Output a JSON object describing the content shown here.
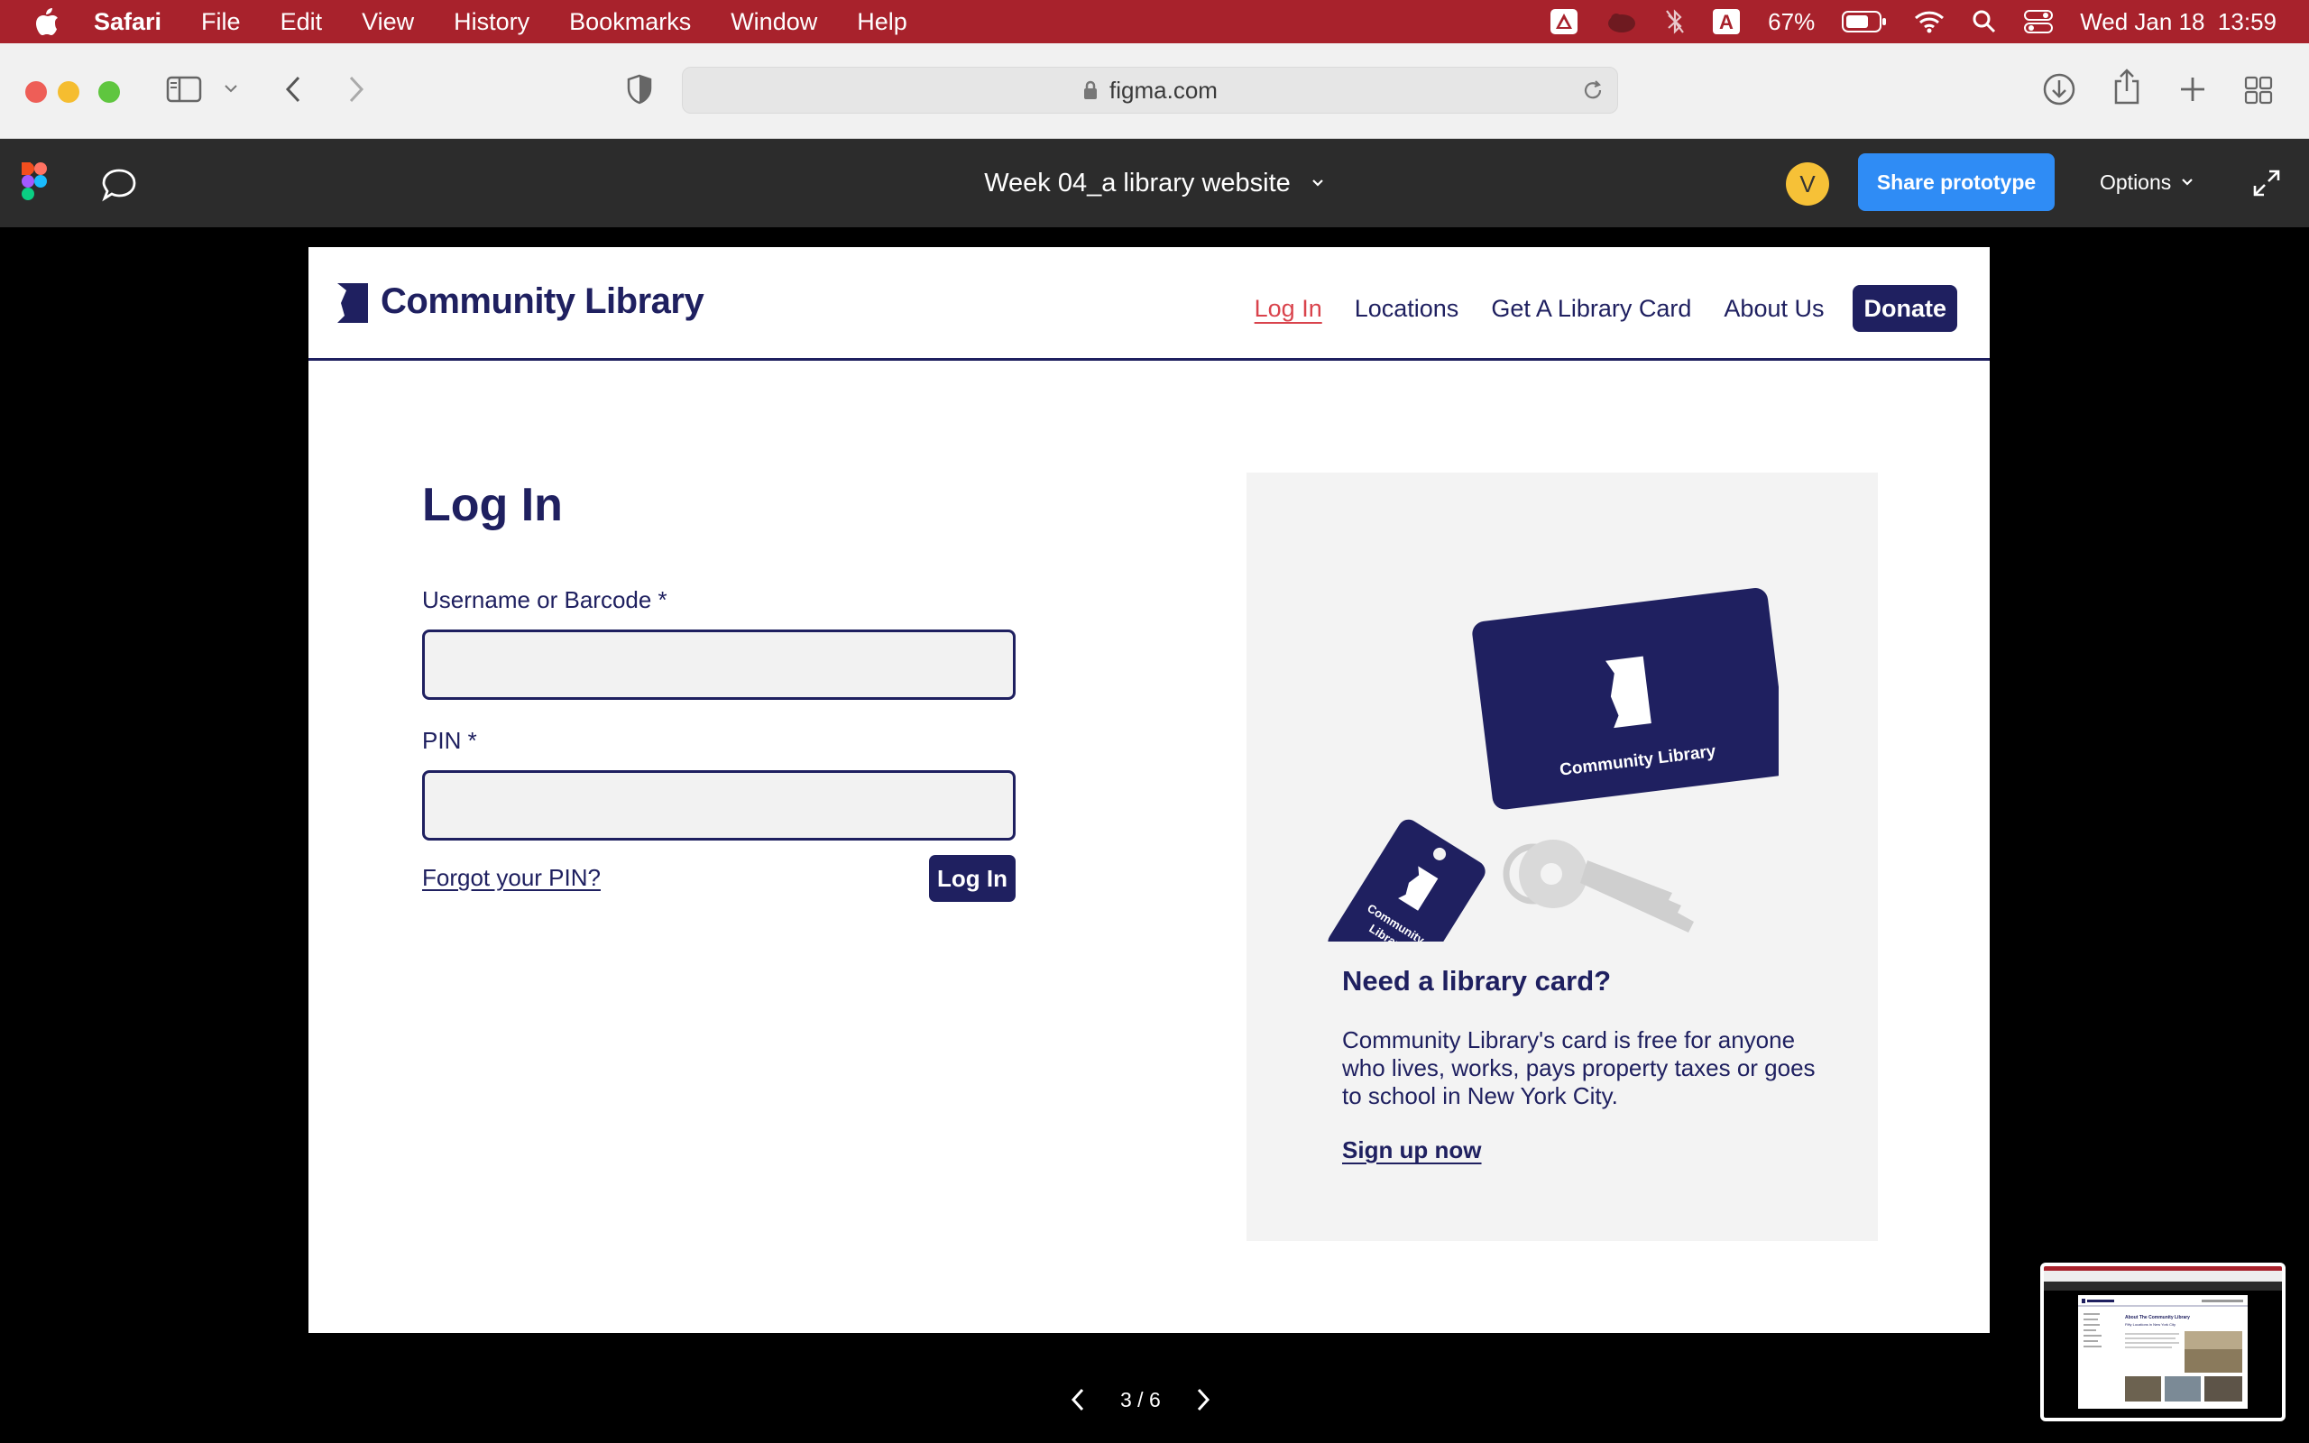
{
  "menubar": {
    "app": "Safari",
    "items": [
      "File",
      "Edit",
      "View",
      "History",
      "Bookmarks",
      "Window",
      "Help"
    ],
    "battery": "67%",
    "datetime": "Wed Jan 18  13:59",
    "font_icon_letter": "A"
  },
  "safari": {
    "url": "figma.com"
  },
  "figma": {
    "file_title": "Week 04_a library website",
    "avatar_initial": "V",
    "share_label": "Share prototype",
    "options_label": "Options"
  },
  "site": {
    "logo_text": "Community Library",
    "nav": [
      "Log In",
      "Locations",
      "Get A Library Card",
      "About Us"
    ],
    "donate": "Donate",
    "login": {
      "title": "Log In",
      "username_label": "Username or Barcode *",
      "username_value": "",
      "pin_label": "PIN *",
      "pin_value": "",
      "forgot": "Forgot your PIN?",
      "submit": "Log In"
    },
    "promo": {
      "card_text": "Community Library",
      "tag_text_1": "Community",
      "tag_text_2": "Library",
      "heading": "Need a library card?",
      "body": "Community Library's card is free for anyone who lives, works, pays property taxes or goes to school in New York City.",
      "link": "Sign up now"
    }
  },
  "pager": {
    "current": "3 / 6"
  },
  "thumbnail": {
    "title": "About The Community Library",
    "subtitle": "Fifty Locations in New York City"
  },
  "colors": {
    "navy": "#1f2060",
    "accent_red": "#d9434c",
    "menubar": "#a8222c",
    "figma_blue": "#2f8cf5"
  }
}
